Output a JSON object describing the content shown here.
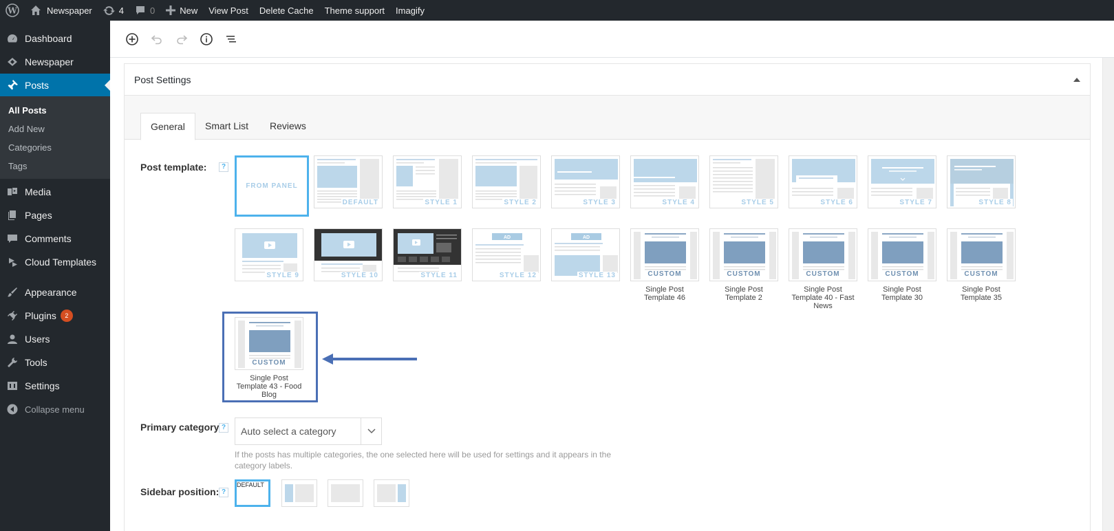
{
  "adminbar": {
    "site_name": "Newspaper",
    "updates_count": "4",
    "comments_count": "0",
    "new_label": "New",
    "view_post": "View Post",
    "delete_cache": "Delete Cache",
    "theme_support": "Theme support",
    "imagify": "Imagify"
  },
  "sidebar": {
    "items": [
      {
        "label": "Dashboard",
        "icon": "dashboard-icon"
      },
      {
        "label": "Newspaper",
        "icon": "newspaper-icon"
      },
      {
        "label": "Posts",
        "icon": "pin-icon",
        "current": true
      },
      {
        "label": "Media",
        "icon": "media-icon"
      },
      {
        "label": "Pages",
        "icon": "pages-icon"
      },
      {
        "label": "Comments",
        "icon": "comments-icon"
      },
      {
        "label": "Cloud Templates",
        "icon": "cloud-templates-icon"
      },
      {
        "label": "Appearance",
        "icon": "paintbrush-icon"
      },
      {
        "label": "Plugins",
        "icon": "plugin-icon",
        "badge": "2"
      },
      {
        "label": "Users",
        "icon": "users-icon"
      },
      {
        "label": "Tools",
        "icon": "wrench-icon"
      },
      {
        "label": "Settings",
        "icon": "settings-icon"
      }
    ],
    "posts_submenu": [
      "All Posts",
      "Add New",
      "Categories",
      "Tags"
    ],
    "collapse": "Collapse menu"
  },
  "panel": {
    "title": "Post Settings",
    "tabs": [
      "General",
      "Smart List",
      "Reviews"
    ]
  },
  "post_template": {
    "label": "Post template:",
    "help": "?",
    "row1": [
      "FROM PANEL",
      "DEFAULT",
      "STYLE 1",
      "STYLE 2",
      "STYLE 3",
      "STYLE 4",
      "STYLE 5",
      "STYLE 6",
      "STYLE 7",
      "STYLE 8"
    ],
    "row2": [
      "STYLE 9",
      "STYLE 10",
      "STYLE 11",
      "STYLE 12",
      "STYLE 13"
    ],
    "ad_label": "AD",
    "custom_label": "CUSTOM",
    "custom": [
      "Single Post Template 46",
      "Single Post Template 2",
      "Single Post Template 40 - Fast News",
      "Single Post Template 30",
      "Single Post Template 35",
      "Single Post Template 43 - Food Blog"
    ]
  },
  "primary_category": {
    "label": "Primary category:",
    "help": "?",
    "value": "Auto select a category",
    "description": "If the posts has multiple categories, the one selected here will be used for settings and it appears in the category labels."
  },
  "sidebar_position": {
    "label": "Sidebar position:",
    "help": "?",
    "default_label": "DEFAULT"
  },
  "colors": {
    "admin_dark": "#23282d",
    "accent_blue": "#0073aa",
    "select_blue": "#4db2ec",
    "highlight": "#4a6fb5",
    "badge": "#d54e21"
  }
}
